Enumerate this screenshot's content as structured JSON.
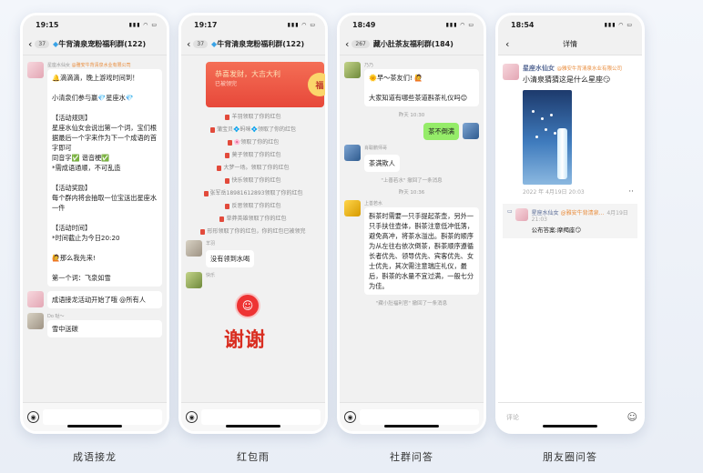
{
  "phones": [
    {
      "time": "19:15",
      "count": "37",
      "title": "牛背清泉宠粉福利群(122)"
    },
    {
      "time": "19:17",
      "count": "37",
      "title": "牛背清泉宠粉福利群(122)"
    },
    {
      "time": "18:49",
      "count": "267",
      "title": "藏小肚茶友福利群(184)"
    },
    {
      "time": "18:54",
      "title": "详情"
    }
  ],
  "p1": {
    "sender": "星座水仙女",
    "tag": "@雅安牛背清泉水业有限公司",
    "bubble1": "🔔滴滴滴，晚上游戏时间到！\n\n小清泉们参与赢💎星座水💎\n\n【活动规则】\n星座水仙女会说出第一个词，宝们根据最后一个字来作为下一个成语的首字即可\n同音字✅ 谐音梗✅\n*需成语通顺，不可乱造\n\n【活动奖励】\n每个群内将会抽取一位宝送出星座水一件\n\n【活动时间】\n*时间截止为今日20:20\n\n🙋那么我先来!\n\n第一个词：飞泉如雪",
    "bubble2": "成语接龙活动开始了哦 @所有人",
    "last_sender": "Do 哒～",
    "last_text": "雪中送碳"
  },
  "p2": {
    "redpacket_title": "恭喜发财，大吉大利",
    "redpacket_sub": "已被领完",
    "redpacket_badge": "福",
    "claims": [
      "羊羽领取了你的红包",
      "蒲宝贝💠蚂咪💠领取了你的红包",
      "🌸领取了你的红包",
      "莫子领取了你的红包",
      "大梦一场。领取了你的红包",
      "快乐领取了你的红包",
      "张军岳18981612893领取了你的红包",
      "反思领取了你的红包",
      "草莽英雄领取了你的红包",
      "形形领取了你的红包，你的红包已被领完"
    ],
    "red_word": "红包",
    "sender1": "羊羽",
    "text1": "没有领到水喝",
    "sender2": "快乐",
    "thanks": "谢谢"
  },
  "p3": {
    "sender1": "乃乃",
    "text1": "🌞早～茶友们! 🙋\n\n大家知道有哪些茶道斟茶礼仪吗😊",
    "time1": "昨天 10:30",
    "right_text": "茶不倒满",
    "sender2": "肖聪鹏师哥",
    "text2": "茶满欺人",
    "recall1": "\"上善若水\" 撤回了一条消息",
    "time2": "昨天 10:36",
    "sender3": "上善若水",
    "text3": "斟茶时需要一只手提起茶壶，另外一只手扶住壶体，斟茶注意低冲低落，避免高冲，将茶水溢出。斟茶的顺序为从左往右依次倒茶，斟茶顺序遵循长者优先、领导优先、宾客优先、女士优先，其次需注意瑞庄礼仪，最后，斟茶的水量不宜过满，一般七分为佳。",
    "recall2": "\"藏小肚福利官\" 撤回了一条消息"
  },
  "p4": {
    "name": "星座水仙女",
    "tag": "@雅安牛背清泉水业有限公司",
    "text": "小清泉猜猜这是什么星座😏",
    "date": "2022 年 4月19日 20:03",
    "c_name": "星座水仙女",
    "c_tag": "@雅安牛背清泉...",
    "c_time": "4月19日 21:03",
    "c_text": "公布答案:摩羯座😏",
    "comment_placeholder": "评论"
  },
  "captions": [
    "成语接龙",
    "红包雨",
    "社群问答",
    "朋友圈问答"
  ]
}
